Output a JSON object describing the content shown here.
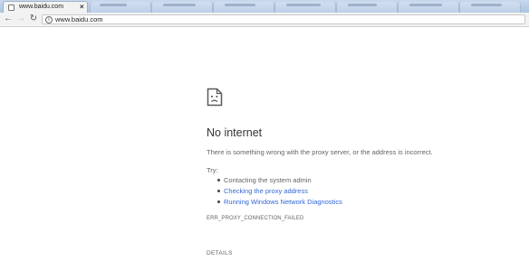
{
  "browser": {
    "active_tab": {
      "title": "www.baidu.com",
      "close_glyph": "×"
    },
    "toolbar": {
      "back_glyph": "←",
      "forward_glyph": "→",
      "reload_glyph": "↻",
      "info_glyph": "i",
      "url": "www.baidu.com"
    }
  },
  "error_page": {
    "icon": "sad-page-icon",
    "title": "No internet",
    "description": "There is something wrong with the proxy server, or the address is incorrect.",
    "try_label": "Try:",
    "suggestions": [
      {
        "text": "Contacting the system admin",
        "is_link": false
      },
      {
        "text": "Checking the proxy address",
        "is_link": true
      },
      {
        "text": "Running Windows Network Diagnostics",
        "is_link": true
      }
    ],
    "error_code": "ERR_PROXY_CONNECTION_FAILED",
    "details_label": "DETAILS"
  },
  "colors": {
    "link": "#3367d6",
    "text": "#646464",
    "title": "#333333",
    "tabstrip": "#aac3e2"
  }
}
